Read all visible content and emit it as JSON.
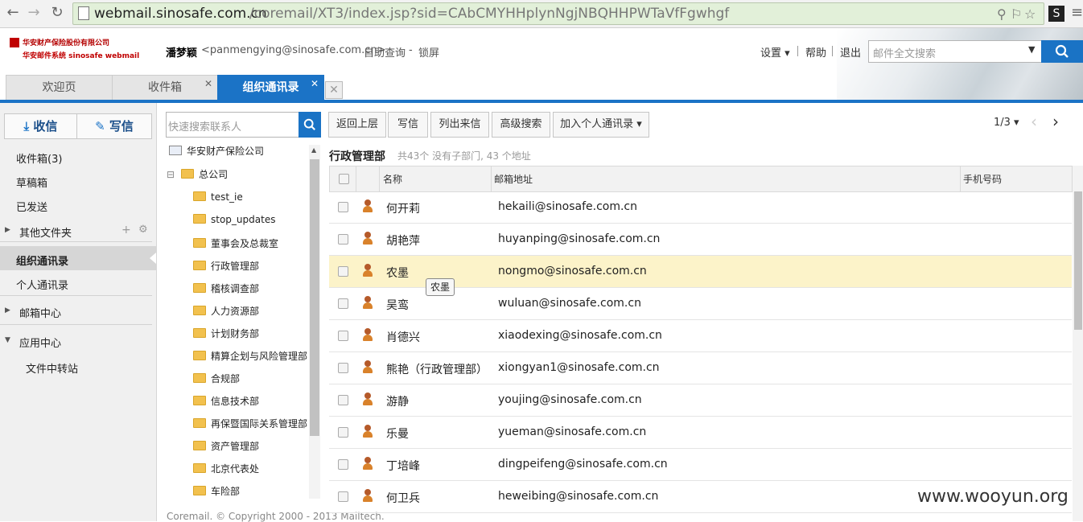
{
  "browser": {
    "url_host": "webmail.sinosafe.com.cn",
    "url_path": "/coremail/XT3/index.jsp?sid=CAbCMYHHplynNgjNBQHHPWTaVfFgwhgf",
    "ext_label": "S"
  },
  "logo": {
    "company": "华安财产保险股份有限公司",
    "system": "华安邮件系统    sinosafe webmail"
  },
  "header": {
    "user_name": "潘梦颖",
    "user_email": "<panmengying@sinosafe.com.cn>",
    "link_query": "自助查询",
    "dash": "-",
    "link_lock": "锁屏",
    "settings": "设置 ▾",
    "help": "帮助",
    "logout": "退出",
    "search_placeholder": "邮件全文搜索"
  },
  "tabs": [
    {
      "label": "欢迎页"
    },
    {
      "label": "收件箱"
    },
    {
      "label": "组织通讯录"
    }
  ],
  "sidebar": {
    "receive_label": "收信",
    "compose_label": "写信",
    "items": [
      {
        "label": "收件箱(3)"
      },
      {
        "label": "草稿箱"
      },
      {
        "label": "已发送"
      },
      {
        "label": "其他文件夹"
      },
      {
        "label": "组织通讯录"
      },
      {
        "label": "个人通讯录"
      },
      {
        "label": "邮箱中心"
      },
      {
        "label": "应用中心"
      },
      {
        "label": "文件中转站"
      }
    ]
  },
  "tree": {
    "search_placeholder": "快速搜索联系人",
    "root": "华安财产保险公司",
    "branch": "总公司",
    "folders": [
      "test_ie",
      "stop_updates",
      "董事会及总裁室",
      "行政管理部",
      "稽核调查部",
      "人力资源部",
      "计划财务部",
      "精算企划与风险管理部",
      "合规部",
      "信息技术部",
      "再保暨国际关系管理部",
      "资产管理部",
      "北京代表处",
      "车险部"
    ]
  },
  "toolbar": {
    "btn_up": "返回上层",
    "btn_write": "写信",
    "btn_list": "列出来信",
    "btn_adv": "高级搜索",
    "btn_add": "加入个人通讯录 ▾",
    "pager": "1/3 ▾"
  },
  "list": {
    "dept": "行政管理部",
    "info": "共43个 没有子部门, 43 个地址",
    "col_name": "名称",
    "col_email": "邮箱地址",
    "col_phone": "手机号码",
    "tooltip": "农墨",
    "rows": [
      {
        "name": "何开莉",
        "email": "hekaili@sinosafe.com.cn"
      },
      {
        "name": "胡艳萍",
        "email": "huyanping@sinosafe.com.cn"
      },
      {
        "name": "农墨",
        "email": "nongmo@sinosafe.com.cn"
      },
      {
        "name": "吴鸾",
        "email": "wuluan@sinosafe.com.cn"
      },
      {
        "name": "肖德兴",
        "email": "xiaodexing@sinosafe.com.cn"
      },
      {
        "name": "熊艳（行政管理部）",
        "email": "xiongyan1@sinosafe.com.cn"
      },
      {
        "name": "游静",
        "email": "youjing@sinosafe.com.cn"
      },
      {
        "name": "乐曼",
        "email": "yueman@sinosafe.com.cn"
      },
      {
        "name": "丁培峰",
        "email": "dingpeifeng@sinosafe.com.cn"
      },
      {
        "name": "何卫兵",
        "email": "heweibing@sinosafe.com.cn"
      }
    ]
  },
  "footer": {
    "copyright": "Coremail. © Copyright 2000 - 2013 Mailtech."
  },
  "watermark": "www.wooyun.org"
}
